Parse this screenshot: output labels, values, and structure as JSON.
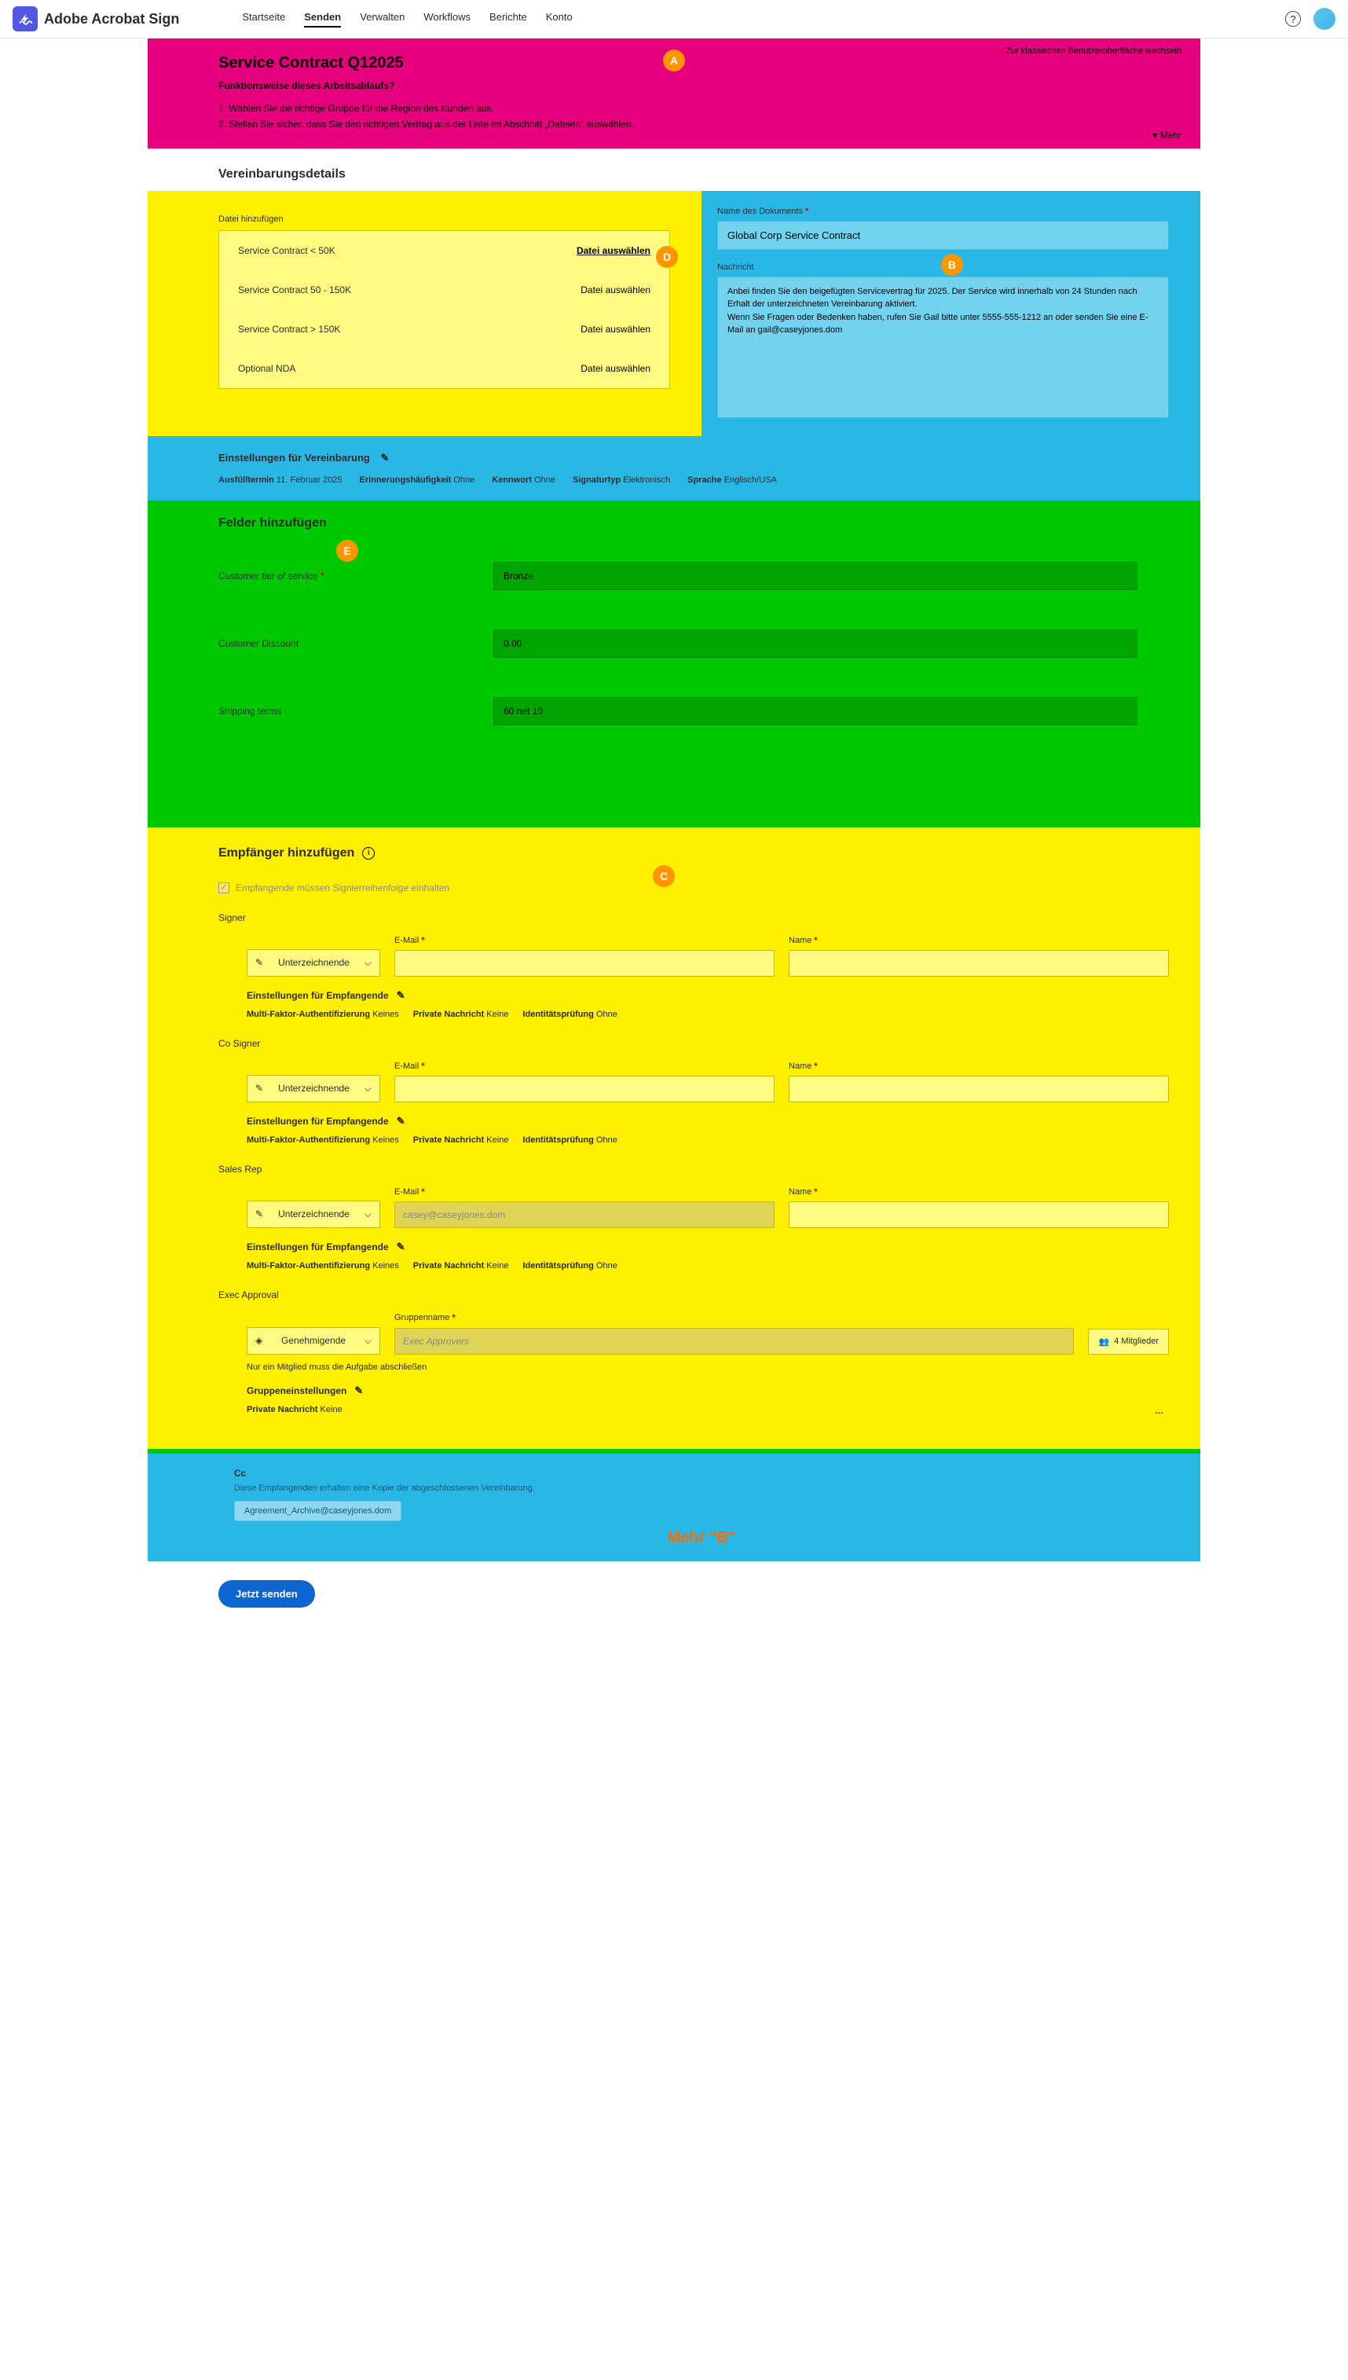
{
  "app": {
    "name": "Adobe Acrobat Sign"
  },
  "nav": {
    "items": [
      "Startseite",
      "Senden",
      "Verwalten",
      "Workflows",
      "Berichte",
      "Konto"
    ],
    "activeIndex": 1
  },
  "banner": {
    "title": "Service Contract Q12025",
    "subtitle": "Funktionsweise dieses Arbeitsablaufs?",
    "line1": "1. Wählen Sie die richtige Gruppe für die Region des Kunden aus.",
    "line2": "2. Stellen Sie sicher, dass Sie den richtigen Vertrag aus der Liste im Abschnitt „Dateien“ auswählen.",
    "classic": "Zur klassischen Benutzeroberfläche wechseln",
    "mehr": "Mehr"
  },
  "details": {
    "heading": "Vereinbarungsdetails",
    "filesLabel": "Datei hinzufügen",
    "files": [
      {
        "name": "Service Contract < 50K",
        "action": "Datei auswählen",
        "primary": true
      },
      {
        "name": "Service Contract 50 - 150K",
        "action": "Datei auswählen",
        "primary": false
      },
      {
        "name": "Service Contract > 150K",
        "action": "Datei auswählen",
        "primary": false
      },
      {
        "name": "Optional NDA",
        "action": "Datei auswählen",
        "primary": false
      }
    ],
    "docNameLabel": "Name des Dokuments",
    "docName": "Global Corp Service Contract",
    "msgLabel": "Nachricht",
    "msg": "Anbei finden Sie den beigefügten Servicevertrag für 2025. Der Service wird innerhalb von 24 Stunden nach Erhalt der unterzeichneten Vereinbarung aktiviert.\nWenn Sie Fragen oder Bedenken haben, rufen Sie Gail bitte unter 5555-555-1212 an oder senden Sie eine E-Mail an gail@caseyjones.dom"
  },
  "settings": {
    "title": "Einstellungen für Vereinbarung",
    "items": {
      "deadlineLbl": "Ausfülltermin",
      "deadlineVal": "11. Februar 2025",
      "reminderLbl": "Erinnerungshäufigkeit",
      "reminderVal": "Ohne",
      "passwordLbl": "Kennwort",
      "passwordVal": "Ohne",
      "sigtypeLbl": "Signaturtyp",
      "sigtypeVal": "Elektronisch",
      "langLbl": "Sprache",
      "langVal": "Englisch/USA"
    }
  },
  "fields": {
    "title": "Felder hinzufügen",
    "rows": [
      {
        "label": "Customer tier of service",
        "required": true,
        "value": "Bronze"
      },
      {
        "label": "Customer Discount",
        "required": false,
        "value": "0.00"
      },
      {
        "label": "Shipping terms",
        "required": false,
        "value": "60 net 10"
      }
    ]
  },
  "recipients": {
    "title": "Empfänger hinzufügen",
    "checkboxLabel": "Empfangende müssen Signierreihenfolge einhalten",
    "emailLbl": "E-Mail",
    "nameLbl": "Name",
    "groupLbl": "Gruppenname",
    "membersLbl": "4 Mitglieder",
    "settingsTitle": "Einstellungen für Empfangende",
    "groupSettingsTitle": "Gruppeneinstellungen",
    "mfaLbl": "Multi-Faktor-Authentifizierung",
    "mfaVal": "Keines",
    "privLbl": "Private Nachricht",
    "privVal": "Keine",
    "idLbl": "Identitätsprüfung",
    "idVal": "Ohne",
    "roleSigner": "Unterzeichnende",
    "roleApprover": "Genehmigende",
    "blocks": [
      {
        "role": "Signer",
        "type": "signer",
        "email": "",
        "name": ""
      },
      {
        "role": "Co Signer",
        "type": "signer",
        "email": "",
        "name": ""
      },
      {
        "role": "Sales Rep",
        "type": "signer",
        "email": "casey@caseyjones.dom",
        "prefilled": true,
        "name": ""
      },
      {
        "role": "Exec Approval",
        "type": "group",
        "groupName": "Exec Approvers",
        "note": "Nur ein Mitglied muss die Aufgabe abschließen"
      }
    ]
  },
  "cc": {
    "title": "Cc",
    "sub": "Diese Empfangenden erhalten eine Kopie der abgeschlossenen Vereinbarung.",
    "chip": "Agreement_Archive@caseyjones.dom",
    "mehrB": "Mehr \"B\""
  },
  "sendBtn": "Jetzt senden",
  "callouts": {
    "a": "A",
    "b": "B",
    "c": "C",
    "d": "D",
    "e": "E"
  }
}
